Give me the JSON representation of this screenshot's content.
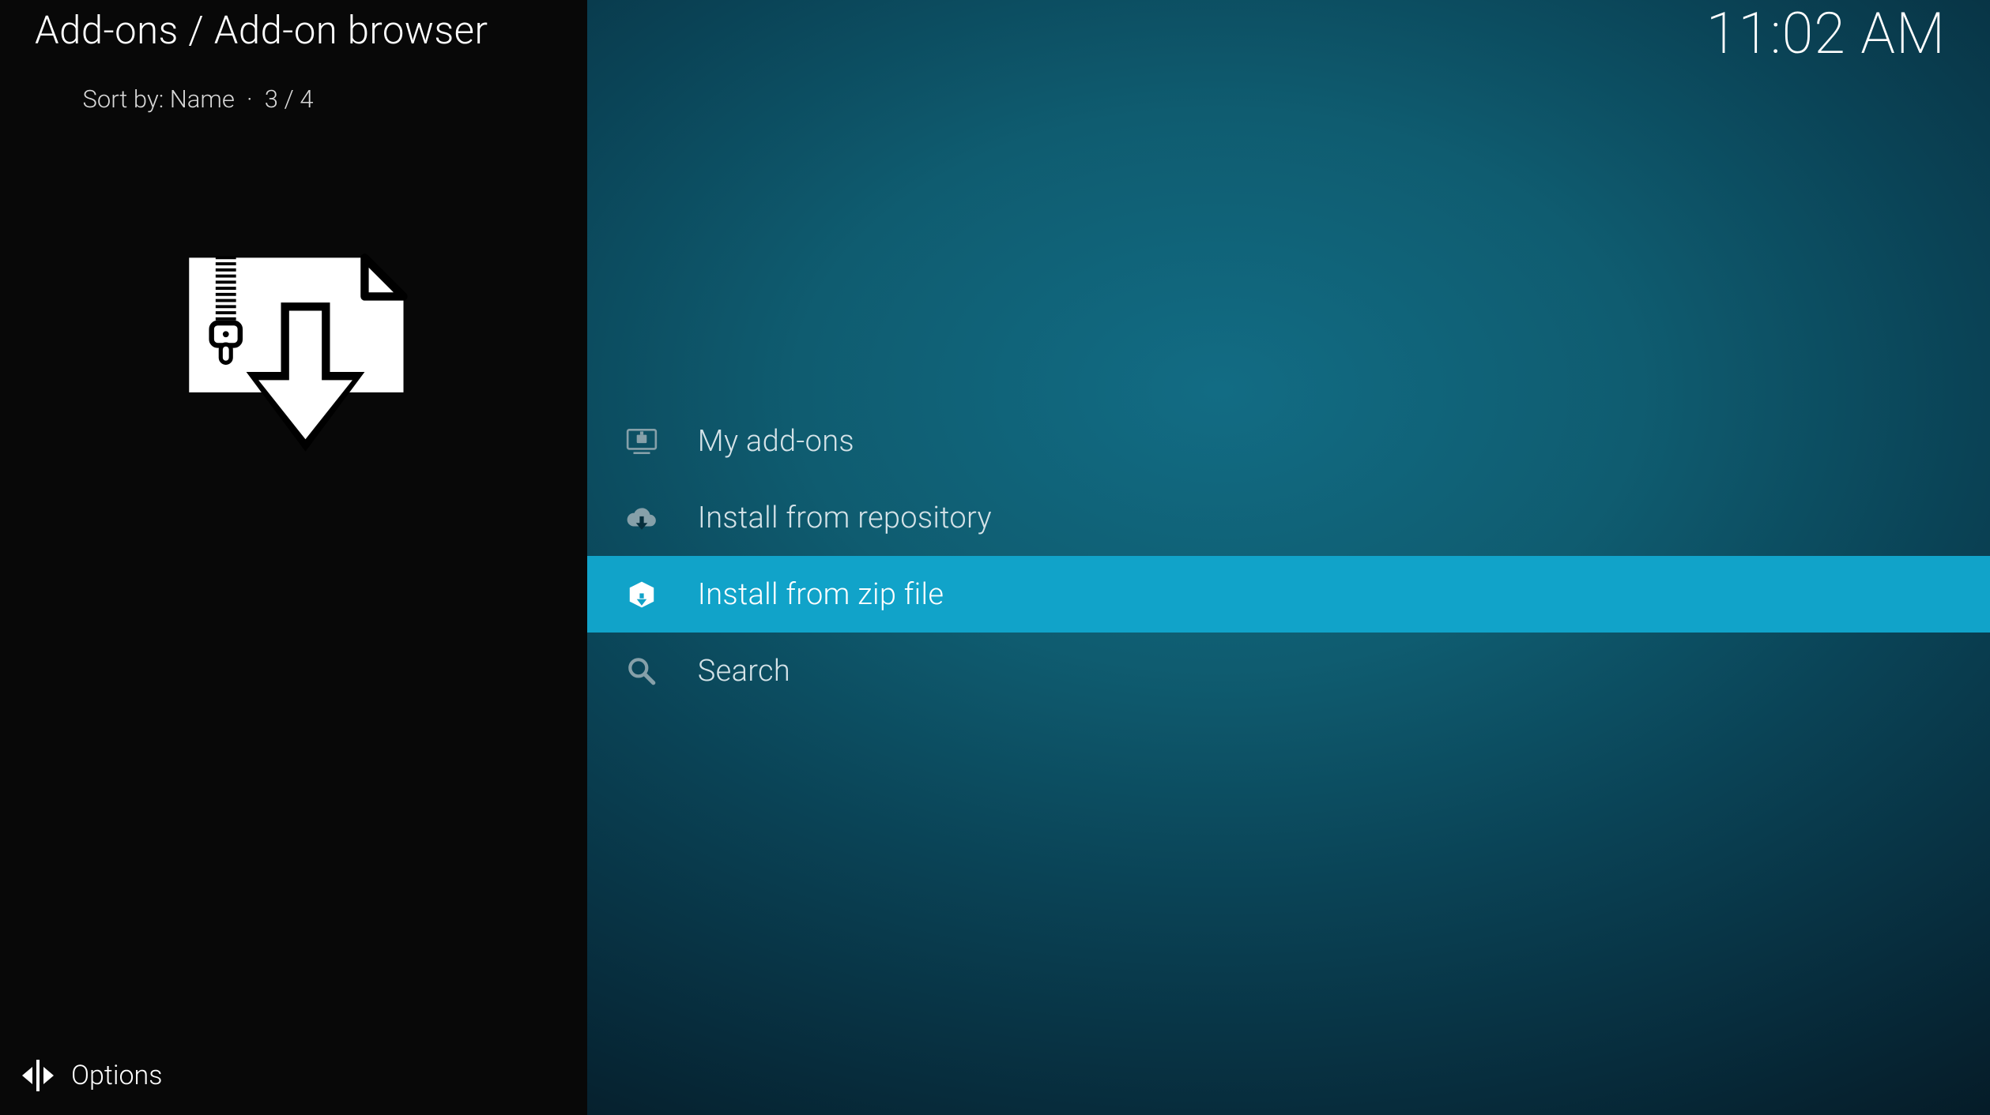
{
  "header": {
    "breadcrumb": "Add-ons / Add-on browser",
    "sort_label": "Sort by: Name",
    "count_separator": "·",
    "count": "3 / 4",
    "clock": "11:02 AM"
  },
  "sidebar": {
    "icon": "zip-download-icon",
    "footer": {
      "options_label": "Options"
    }
  },
  "menu": {
    "items": [
      {
        "label": "My add-ons",
        "icon": "monitor-box-icon",
        "selected": false
      },
      {
        "label": "Install from repository",
        "icon": "cloud-download-icon",
        "selected": false
      },
      {
        "label": "Install from zip file",
        "icon": "box-download-icon",
        "selected": true
      },
      {
        "label": "Search",
        "icon": "search-icon",
        "selected": false
      }
    ]
  }
}
